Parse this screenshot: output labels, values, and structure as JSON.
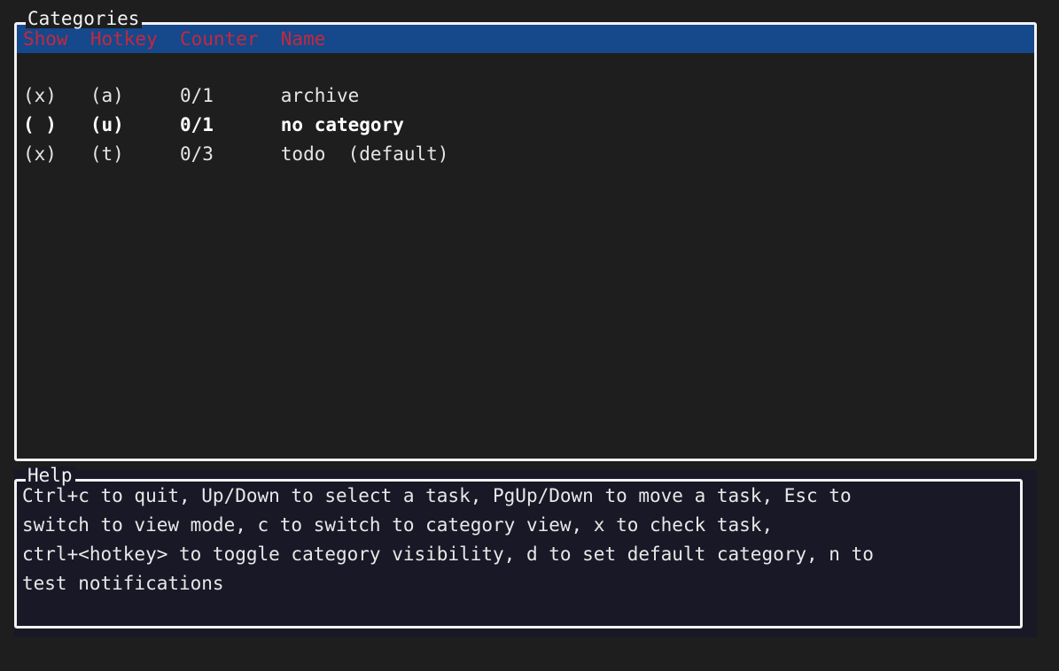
{
  "app": {
    "background_color": "#1e1e1e",
    "accent_blue": "#16488c",
    "accent_red": "#c4293c",
    "border_color": "#f2f2f2",
    "help_background": "#181827"
  },
  "categories_panel": {
    "title": "Categories",
    "header_row": "Show  Hotkey  Counter  Name",
    "header_columns": [
      "Show",
      "Hotkey",
      "Counter",
      "Name"
    ],
    "rows": [
      {
        "text": "(x)   (a)     0/1      archive",
        "show": "(x)",
        "hotkey": "(a)",
        "counter": "0/1",
        "name": "archive",
        "selected": false
      },
      {
        "text": "( )   (u)     0/1      no category",
        "show": "( )",
        "hotkey": "(u)",
        "counter": "0/1",
        "name": "no category",
        "selected": true
      },
      {
        "text": "(x)   (t)     0/3      todo  (default)",
        "show": "(x)",
        "hotkey": "(t)",
        "counter": "0/3",
        "name": "todo  (default)",
        "selected": false
      }
    ]
  },
  "help_panel": {
    "title": "Help",
    "lines": [
      "Ctrl+c to quit, Up/Down to select a task, PgUp/Down to move a task, Esc to",
      "switch to view mode, c to switch to category view, x to check task,",
      "ctrl+<hotkey> to toggle category visibility, d to set default category, n to",
      "test notifications"
    ],
    "full_text": "Ctrl+c to quit, Up/Down to select a task, PgUp/Down to move a task, Esc to switch to view mode, c to switch to category view, x to check task, ctrl+<hotkey> to toggle category visibility, d to set default category, n to test notifications"
  }
}
